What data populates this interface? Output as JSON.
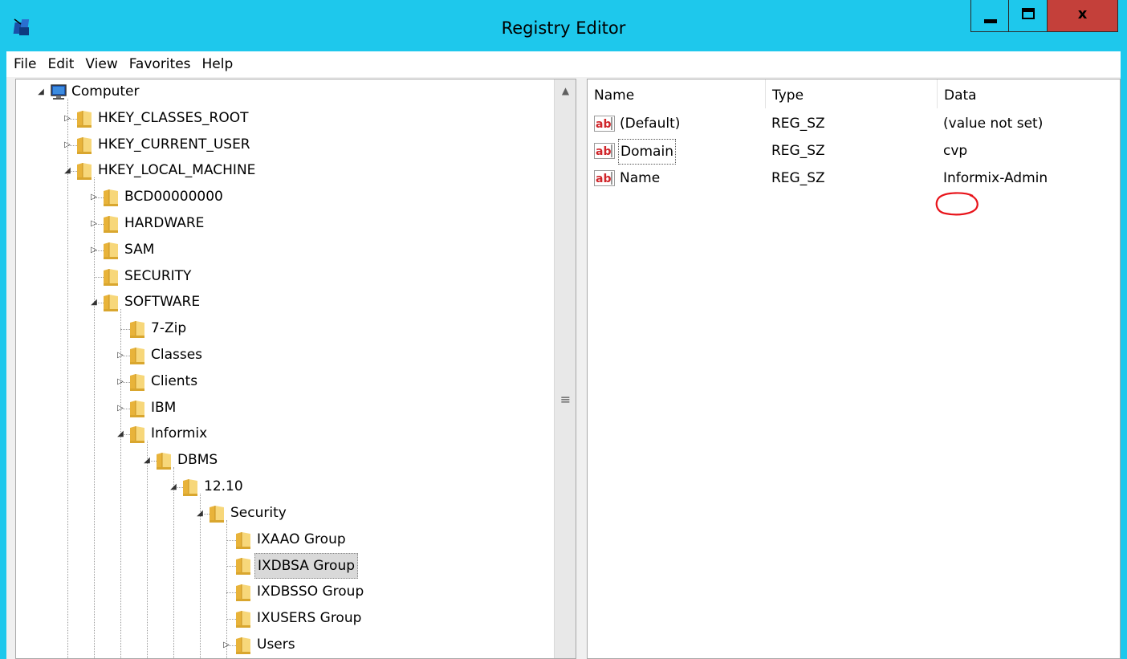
{
  "window": {
    "title": "Registry Editor",
    "app_icon": "regedit-icon",
    "controls": {
      "minimize": "minimize-icon",
      "maximize": "maximize-icon",
      "close_label": "x"
    },
    "accent": "#1ec8ec",
    "close_color": "#c4403a"
  },
  "menu": [
    "File",
    "Edit",
    "View",
    "Favorites",
    "Help"
  ],
  "tree": [
    {
      "label": "Computer",
      "depth": 0,
      "expander": "expanded",
      "icon": "computer-icon"
    },
    {
      "label": "HKEY_CLASSES_ROOT",
      "depth": 1,
      "expander": "collapsed",
      "icon": "folder-icon"
    },
    {
      "label": "HKEY_CURRENT_USER",
      "depth": 1,
      "expander": "collapsed",
      "icon": "folder-icon"
    },
    {
      "label": "HKEY_LOCAL_MACHINE",
      "depth": 1,
      "expander": "expanded",
      "icon": "folder-icon"
    },
    {
      "label": "BCD00000000",
      "depth": 2,
      "expander": "collapsed",
      "icon": "folder-icon"
    },
    {
      "label": "HARDWARE",
      "depth": 2,
      "expander": "collapsed",
      "icon": "folder-icon"
    },
    {
      "label": "SAM",
      "depth": 2,
      "expander": "collapsed",
      "icon": "folder-icon"
    },
    {
      "label": "SECURITY",
      "depth": 2,
      "expander": "none",
      "icon": "folder-icon"
    },
    {
      "label": "SOFTWARE",
      "depth": 2,
      "expander": "expanded",
      "icon": "folder-icon"
    },
    {
      "label": "7-Zip",
      "depth": 3,
      "expander": "none",
      "icon": "folder-icon"
    },
    {
      "label": "Classes",
      "depth": 3,
      "expander": "collapsed",
      "icon": "folder-icon"
    },
    {
      "label": "Clients",
      "depth": 3,
      "expander": "collapsed",
      "icon": "folder-icon"
    },
    {
      "label": "IBM",
      "depth": 3,
      "expander": "collapsed",
      "icon": "folder-icon"
    },
    {
      "label": "Informix",
      "depth": 3,
      "expander": "expanded",
      "icon": "folder-icon"
    },
    {
      "label": "DBMS",
      "depth": 4,
      "expander": "expanded",
      "icon": "folder-icon"
    },
    {
      "label": "12.10",
      "depth": 5,
      "expander": "expanded",
      "icon": "folder-icon"
    },
    {
      "label": "Security",
      "depth": 6,
      "expander": "expanded",
      "icon": "folder-icon"
    },
    {
      "label": "IXAAO Group",
      "depth": 7,
      "expander": "none",
      "icon": "folder-icon"
    },
    {
      "label": "IXDBSA Group",
      "depth": 7,
      "expander": "none",
      "icon": "folder-icon",
      "selected": true
    },
    {
      "label": "IXDBSSO Group",
      "depth": 7,
      "expander": "none",
      "icon": "folder-icon"
    },
    {
      "label": "IXUSERS Group",
      "depth": 7,
      "expander": "none",
      "icon": "folder-icon"
    },
    {
      "label": "Users",
      "depth": 7,
      "expander": "collapsed",
      "icon": "folder-icon"
    }
  ],
  "list": {
    "columns": [
      "Name",
      "Type",
      "Data"
    ],
    "rows": [
      {
        "name": "(Default)",
        "type": "REG_SZ",
        "data": "(value not set)",
        "icon": "string-value-icon"
      },
      {
        "name": "Domain",
        "type": "REG_SZ",
        "data": "cvp",
        "icon": "string-value-icon",
        "focused": true,
        "circled": true
      },
      {
        "name": "Name",
        "type": "REG_SZ",
        "data": "Informix-Admin",
        "icon": "string-value-icon"
      }
    ],
    "annotation_color": "#e8141b"
  }
}
